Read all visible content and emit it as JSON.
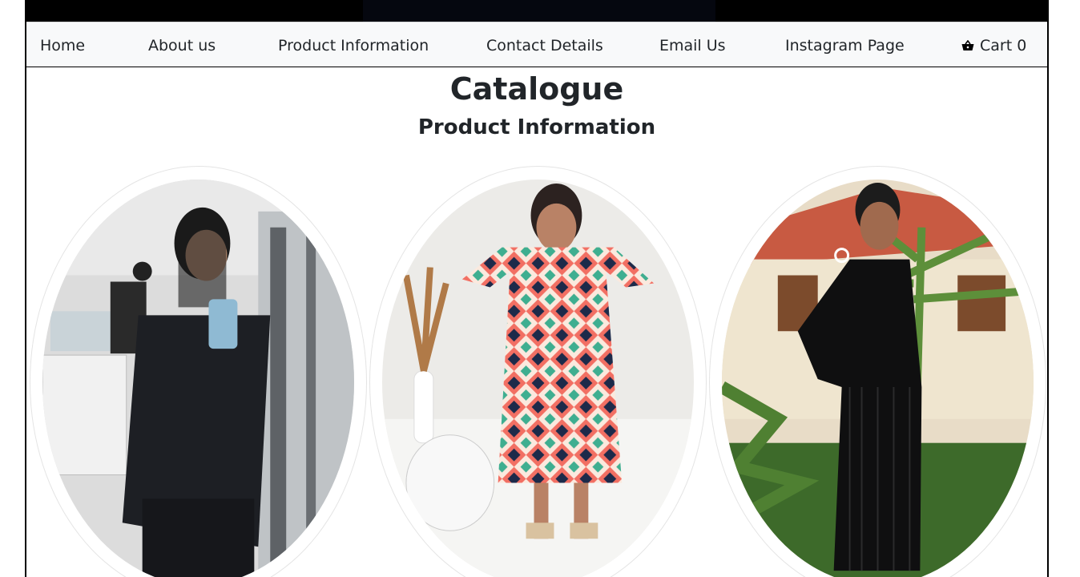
{
  "nav": {
    "items": [
      {
        "label": "Home"
      },
      {
        "label": "About us"
      },
      {
        "label": "Product Information"
      },
      {
        "label": "Contact Details"
      },
      {
        "label": "Email Us"
      },
      {
        "label": "Instagram Page"
      }
    ],
    "cart": {
      "label": "Cart 0",
      "icon": "basket-icon"
    }
  },
  "page": {
    "title": "Catalogue",
    "subtitle": "Product Information"
  },
  "products": [
    {
      "name": "black-blazer-outfit-photo"
    },
    {
      "name": "diamond-print-dress-photo"
    },
    {
      "name": "black-pleated-dress-photo"
    }
  ],
  "colors": {
    "navbar_bg": "#f8f9fa",
    "topbar_bg": "#000000",
    "text": "#212529"
  }
}
